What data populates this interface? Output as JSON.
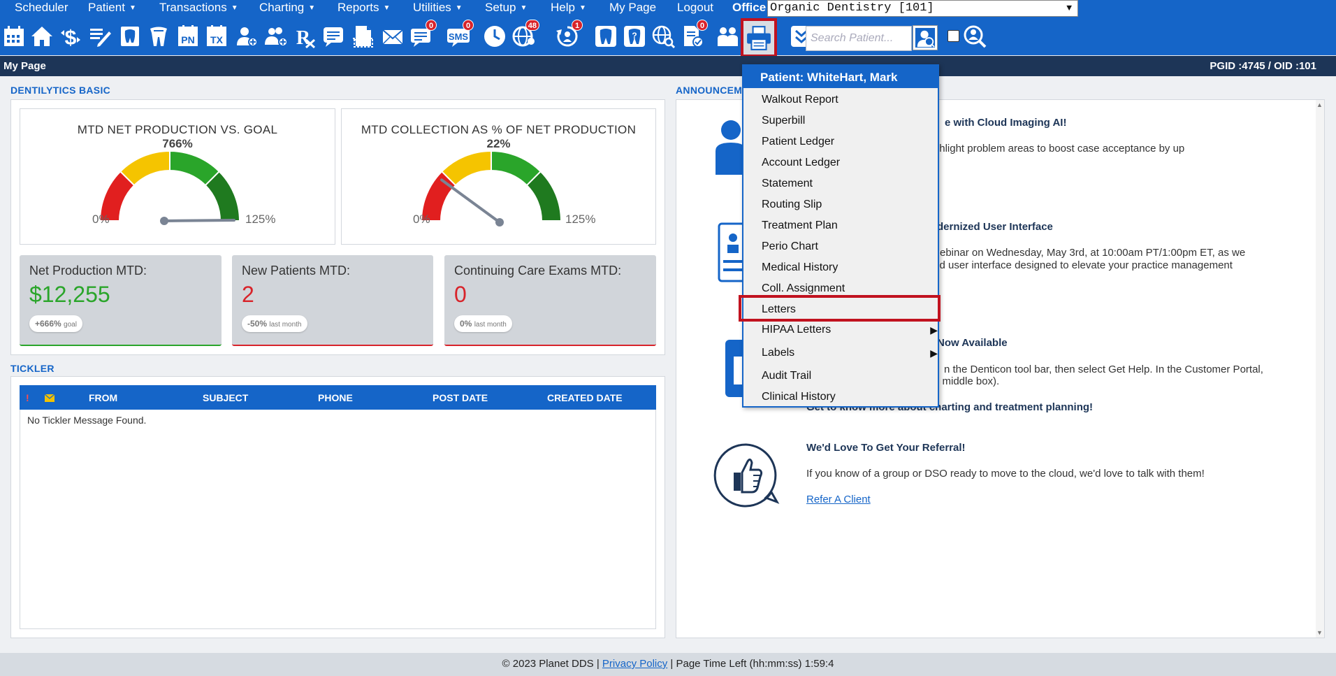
{
  "menu": {
    "items": [
      {
        "label": "Scheduler",
        "caret": false
      },
      {
        "label": "Patient",
        "caret": true
      },
      {
        "label": "Transactions",
        "caret": true
      },
      {
        "label": "Charting",
        "caret": true
      },
      {
        "label": "Reports",
        "caret": true
      },
      {
        "label": "Utilities",
        "caret": true
      },
      {
        "label": "Setup",
        "caret": true
      },
      {
        "label": "Help",
        "caret": true
      },
      {
        "label": "My Page",
        "caret": false
      },
      {
        "label": "Logout",
        "caret": false
      }
    ],
    "caret_glyph": "▼",
    "office_label": "Office",
    "office_value": "Organic Dentistry [101]"
  },
  "toolbar": {
    "search_placeholder": "Search Patient...",
    "tx_label": "TX",
    "pn_label": "PN",
    "sms_label": "SMS",
    "badges": {
      "messages": "0",
      "sms": "0",
      "web": "48",
      "recall": "1",
      "docs": "0"
    }
  },
  "page": {
    "title": "My Page",
    "ids": "PGID :4745  /  OID :101"
  },
  "dentilytics": {
    "section_title": "DENTILYTICS BASIC",
    "gauges": [
      {
        "title": "MTD NET PRODUCTION VS. GOAL",
        "value": "766%",
        "min": "0%",
        "max": "125%",
        "needle_fraction": 1.0
      },
      {
        "title": "MTD COLLECTION AS % OF NET PRODUCTION",
        "value": "22%",
        "min": "0%",
        "max": "125%",
        "needle_fraction": 0.22
      }
    ],
    "stats": [
      {
        "label": "Net Production MTD:",
        "value": "$12,255",
        "pill_value": "+666%",
        "pill_note": "goal",
        "color": "#2aa52a"
      },
      {
        "label": "New Patients MTD:",
        "value": "2",
        "pill_value": "-50%",
        "pill_note": "last month",
        "color": "#d8232a"
      },
      {
        "label": "Continuing Care Exams MTD:",
        "value": "0",
        "pill_value": "0%",
        "pill_note": "last month",
        "color": "#d8232a"
      }
    ]
  },
  "tickler": {
    "section_title": "TICKLER",
    "columns": [
      "FROM",
      "SUBJECT",
      "PHONE",
      "POST DATE",
      "CREATED DATE"
    ],
    "flag": "!",
    "empty_message": "No Tickler Message Found."
  },
  "announcements": {
    "section_title": "ANNOUNCEMENTS",
    "items": [
      {
        "title": "e with Cloud Imaging AI!",
        "text": "l images that highlight problem areas to boost case acceptance by up"
      },
      {
        "title": "dernized User Interface",
        "text1": "ebinar on Wednesday, May 3rd, at 10:00am PT/1:00pm ET, as we",
        "text2": "ted user interface designed to elevate your practice management"
      },
      {
        "title": "Now Available",
        "text1": "n the Denticon tool bar, then select Get Help. In the Customer Portal,",
        "text2": "p middle box).",
        "text3": "Get to know more about charting and treatment planning!"
      },
      {
        "title": "We'd Love To Get Your Referral!",
        "text": "If you know of a group or DSO ready to move to the cloud, we'd love to talk with them!",
        "link": "Refer A Client"
      }
    ]
  },
  "print_menu": {
    "header": "Patient: WhiteHart, Mark",
    "items": [
      {
        "label": "Walkout Report"
      },
      {
        "label": "Superbill"
      },
      {
        "label": "Patient Ledger"
      },
      {
        "label": "Account Ledger"
      },
      {
        "label": "Statement"
      },
      {
        "label": "Routing Slip"
      },
      {
        "label": "Treatment Plan"
      },
      {
        "label": "Perio Chart"
      },
      {
        "label": "Medical History"
      },
      {
        "label": "Coll. Assignment"
      },
      {
        "label": "Letters",
        "highlighted": true
      },
      {
        "label": "HIPAA Letters",
        "submenu": true
      },
      {
        "label": "Labels",
        "submenu": true
      },
      {
        "label": "Audit Trail"
      },
      {
        "label": "Clinical History"
      }
    ],
    "submenu_arrow": "▶"
  },
  "footer": {
    "copyright": "© 2023 Planet DDS | ",
    "privacy": "Privacy Policy",
    "time_left": " |  Page Time Left (hh:mm:ss) 1:59:4"
  },
  "colors": {
    "brand": "#1565c8",
    "dark": "#1d3557",
    "highlight": "#c1121f",
    "green": "#2aa52a",
    "red": "#d8232a"
  }
}
